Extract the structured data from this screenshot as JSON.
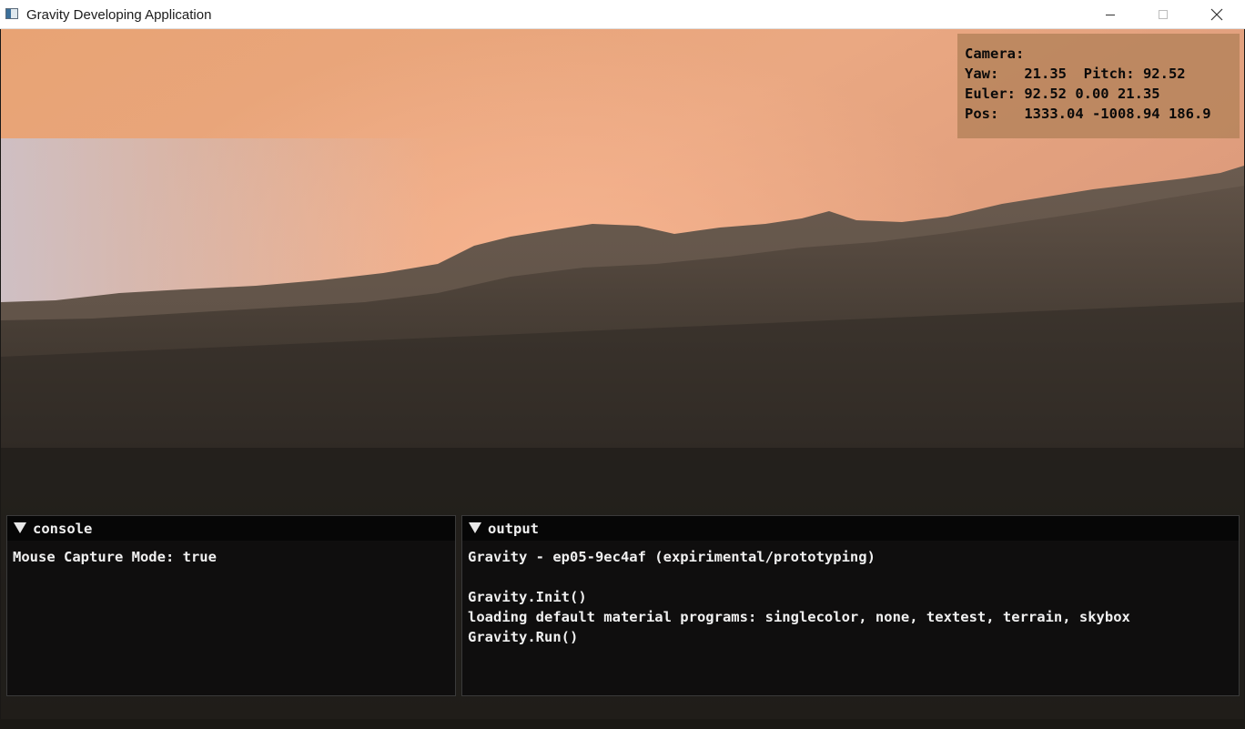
{
  "window": {
    "title": "Gravity Developing Application",
    "icon": "app-window-icon",
    "controls": {
      "minimize_icon": "minimize-icon",
      "maximize_icon": "maximize-icon",
      "close_icon": "close-icon"
    }
  },
  "camera": {
    "line1": "Camera:",
    "line2": "Yaw:   21.35  Pitch: 92.52",
    "line3": "Euler: 92.52 0.00 21.35",
    "line4": "Pos:   1333.04 -1008.94 186.9"
  },
  "console": {
    "title": "console",
    "lines": [
      "Mouse Capture Mode: true"
    ]
  },
  "output": {
    "title": "output",
    "lines": [
      "Gravity - ep05-9ec4af (expirimental/prototyping)",
      "",
      "Gravity.Init()",
      "loading default material programs: singlecolor, none, textest, terrain, skybox",
      "Gravity.Run()"
    ]
  },
  "colors": {
    "sky_top": "#e9a77a",
    "sky_glow": "#f5b08c",
    "mountain": "#5b4d43",
    "ground": "#1d1b17",
    "overlay": "#b4825a",
    "panel_bg": "#0c0c0c",
    "text": "#f0f0f0"
  }
}
